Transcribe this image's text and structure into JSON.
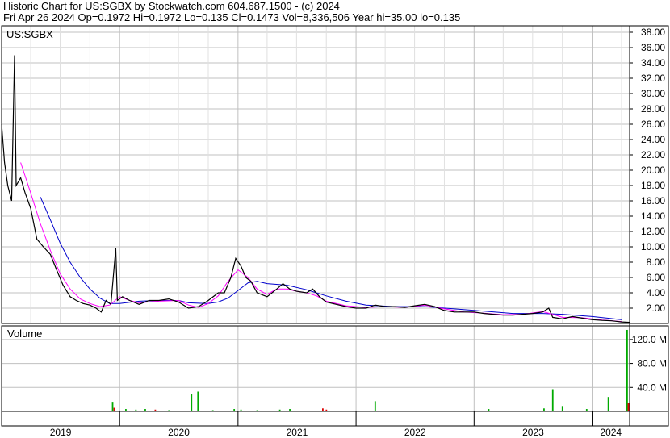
{
  "header": {
    "title": "Historic Chart for US:SGBX by Stockwatch.com 604.687.1500 - (c) 2024",
    "quote": "Fri Apr 26 2024   Op=0.1972  Hi=0.1972  Lo=0.135  Cl=0.1473  Vol=8,336,506  Year hi=35.00  lo=0.135"
  },
  "chart_data": {
    "type": "line",
    "symbol": "US:SGBX",
    "volume_label": "Volume",
    "price_ylim": [
      0,
      38
    ],
    "price_ticks": [
      "2.00",
      "4.00",
      "6.00",
      "8.00",
      "10.00",
      "12.00",
      "14.00",
      "16.00",
      "18.00",
      "20.00",
      "22.00",
      "24.00",
      "26.00",
      "28.00",
      "30.00",
      "32.00",
      "34.00",
      "36.00",
      "38.00"
    ],
    "volume_ylim": [
      0,
      140
    ],
    "volume_ticks": [
      "40.0 M",
      "80.0 M",
      "120.0 M"
    ],
    "x_labels": [
      "2019",
      "2020",
      "2021",
      "2022",
      "2023",
      "2024"
    ],
    "x_range": [
      "2019-01-01",
      "2024-04-26"
    ],
    "grid": true,
    "colors": {
      "price": "#000000",
      "ma_short": "#ff00ff",
      "ma_long": "#0000cc",
      "vol_up": "#00aa00",
      "vol_down": "#dd0000",
      "grid": "#c0c0c0"
    },
    "series": [
      {
        "key": "close",
        "points": [
          [
            "2019-01-01",
            26
          ],
          [
            "2019-01-10",
            21
          ],
          [
            "2019-01-20",
            18
          ],
          [
            "2019-02-01",
            16
          ],
          [
            "2019-02-10",
            35
          ],
          [
            "2019-02-15",
            18
          ],
          [
            "2019-03-01",
            19
          ],
          [
            "2019-03-15",
            17
          ],
          [
            "2019-04-01",
            15
          ],
          [
            "2019-04-20",
            11
          ],
          [
            "2019-05-10",
            10
          ],
          [
            "2019-06-01",
            9
          ],
          [
            "2019-06-20",
            7
          ],
          [
            "2019-07-10",
            5
          ],
          [
            "2019-08-01",
            3.5
          ],
          [
            "2019-08-20",
            3
          ],
          [
            "2019-09-10",
            2.6
          ],
          [
            "2019-10-01",
            2.4
          ],
          [
            "2019-10-20",
            2
          ],
          [
            "2019-11-05",
            1.5
          ],
          [
            "2019-11-20",
            3
          ],
          [
            "2019-12-05",
            2.5
          ],
          [
            "2019-12-20",
            9.8
          ],
          [
            "2019-12-25",
            3
          ],
          [
            "2020-01-10",
            3.5
          ],
          [
            "2020-02-01",
            3
          ],
          [
            "2020-03-01",
            2.5
          ],
          [
            "2020-04-01",
            3
          ],
          [
            "2020-05-01",
            3
          ],
          [
            "2020-06-01",
            3.2
          ],
          [
            "2020-07-01",
            2.8
          ],
          [
            "2020-08-01",
            2
          ],
          [
            "2020-09-01",
            2.2
          ],
          [
            "2020-10-01",
            3
          ],
          [
            "2020-11-01",
            4
          ],
          [
            "2020-11-20",
            4
          ],
          [
            "2020-12-10",
            6
          ],
          [
            "2020-12-25",
            8.5
          ],
          [
            "2021-01-10",
            7.5
          ],
          [
            "2021-01-25",
            6
          ],
          [
            "2021-02-10",
            5.5
          ],
          [
            "2021-03-01",
            4
          ],
          [
            "2021-04-01",
            3.5
          ],
          [
            "2021-05-01",
            4.5
          ],
          [
            "2021-05-20",
            5.2
          ],
          [
            "2021-06-10",
            4.5
          ],
          [
            "2021-07-01",
            4.2
          ],
          [
            "2021-08-01",
            4
          ],
          [
            "2021-08-20",
            4.5
          ],
          [
            "2021-09-10",
            3.5
          ],
          [
            "2021-10-01",
            2.8
          ],
          [
            "2021-11-01",
            2.5
          ],
          [
            "2021-12-01",
            2.2
          ],
          [
            "2022-01-01",
            2
          ],
          [
            "2022-02-01",
            2
          ],
          [
            "2022-03-01",
            2.4
          ],
          [
            "2022-04-01",
            2.2
          ],
          [
            "2022-05-01",
            2.2
          ],
          [
            "2022-06-01",
            2.1
          ],
          [
            "2022-07-01",
            2.3
          ],
          [
            "2022-08-01",
            2.5
          ],
          [
            "2022-09-01",
            2.2
          ],
          [
            "2022-10-01",
            1.7
          ],
          [
            "2022-11-01",
            1.5
          ],
          [
            "2022-12-01",
            1.5
          ],
          [
            "2023-01-01",
            1.5
          ],
          [
            "2023-02-01",
            1.3
          ],
          [
            "2023-03-01",
            1.2
          ],
          [
            "2023-04-01",
            1.1
          ],
          [
            "2023-05-01",
            1.1
          ],
          [
            "2023-06-01",
            1.2
          ],
          [
            "2023-07-01",
            1.3
          ],
          [
            "2023-08-01",
            1.5
          ],
          [
            "2023-08-20",
            2
          ],
          [
            "2023-09-01",
            0.8
          ],
          [
            "2023-10-01",
            0.6
          ],
          [
            "2023-11-01",
            0.9
          ],
          [
            "2023-12-01",
            0.7
          ],
          [
            "2024-01-01",
            0.5
          ],
          [
            "2024-02-01",
            0.4
          ],
          [
            "2024-03-01",
            0.35
          ],
          [
            "2024-04-01",
            0.2
          ],
          [
            "2024-04-26",
            0.1473
          ]
        ]
      },
      {
        "key": "ma_short",
        "points": [
          [
            "2019-03-01",
            21
          ],
          [
            "2019-04-01",
            17
          ],
          [
            "2019-05-01",
            13
          ],
          [
            "2019-06-01",
            9.5
          ],
          [
            "2019-07-01",
            6.5
          ],
          [
            "2019-08-01",
            4.5
          ],
          [
            "2019-09-01",
            3.2
          ],
          [
            "2019-10-01",
            2.6
          ],
          [
            "2019-11-01",
            2.2
          ],
          [
            "2019-12-01",
            2.4
          ],
          [
            "2020-01-01",
            3.5
          ],
          [
            "2020-02-01",
            3
          ],
          [
            "2020-03-01",
            2.7
          ],
          [
            "2020-05-01",
            2.9
          ],
          [
            "2020-07-01",
            3
          ],
          [
            "2020-08-01",
            2.4
          ],
          [
            "2020-09-01",
            2.1
          ],
          [
            "2020-10-01",
            2.6
          ],
          [
            "2020-11-01",
            3.6
          ],
          [
            "2020-12-01",
            5.5
          ],
          [
            "2021-01-01",
            7
          ],
          [
            "2021-02-01",
            6
          ],
          [
            "2021-03-01",
            4.5
          ],
          [
            "2021-04-01",
            3.8
          ],
          [
            "2021-05-01",
            4.5
          ],
          [
            "2021-06-01",
            4.5
          ],
          [
            "2021-07-01",
            4.2
          ],
          [
            "2021-08-01",
            4
          ],
          [
            "2021-09-01",
            3.6
          ],
          [
            "2021-10-01",
            2.9
          ],
          [
            "2021-12-01",
            2.3
          ],
          [
            "2022-02-01",
            2.1
          ],
          [
            "2022-04-01",
            2.2
          ],
          [
            "2022-06-01",
            2.1
          ],
          [
            "2022-08-01",
            2.4
          ],
          [
            "2022-10-01",
            1.9
          ],
          [
            "2022-12-01",
            1.5
          ],
          [
            "2023-02-01",
            1.35
          ],
          [
            "2023-04-01",
            1.15
          ],
          [
            "2023-06-01",
            1.2
          ],
          [
            "2023-08-01",
            1.55
          ],
          [
            "2023-09-01",
            1.2
          ],
          [
            "2023-10-01",
            0.8
          ],
          [
            "2023-12-01",
            0.75
          ],
          [
            "2024-02-01",
            0.45
          ],
          [
            "2024-04-01",
            0.25
          ]
        ]
      },
      {
        "key": "ma_long",
        "points": [
          [
            "2019-05-01",
            16.5
          ],
          [
            "2019-06-01",
            13.5
          ],
          [
            "2019-07-01",
            10.5
          ],
          [
            "2019-08-01",
            8
          ],
          [
            "2019-09-01",
            6
          ],
          [
            "2019-10-01",
            4.5
          ],
          [
            "2019-11-01",
            3.3
          ],
          [
            "2019-12-01",
            2.6
          ],
          [
            "2020-01-01",
            2.6
          ],
          [
            "2020-03-01",
            2.9
          ],
          [
            "2020-05-01",
            3
          ],
          [
            "2020-07-01",
            3
          ],
          [
            "2020-08-01",
            2.7
          ],
          [
            "2020-10-01",
            2.6
          ],
          [
            "2020-11-01",
            2.8
          ],
          [
            "2020-12-01",
            3.3
          ],
          [
            "2021-01-01",
            4.3
          ],
          [
            "2021-02-01",
            5.3
          ],
          [
            "2021-03-01",
            5.5
          ],
          [
            "2021-04-01",
            5.2
          ],
          [
            "2021-06-01",
            5
          ],
          [
            "2021-08-01",
            4.4
          ],
          [
            "2021-10-01",
            3.6
          ],
          [
            "2021-12-01",
            2.9
          ],
          [
            "2022-02-01",
            2.4
          ],
          [
            "2022-05-01",
            2.2
          ],
          [
            "2022-08-01",
            2.2
          ],
          [
            "2022-11-01",
            1.9
          ],
          [
            "2023-02-01",
            1.6
          ],
          [
            "2023-05-01",
            1.3
          ],
          [
            "2023-08-01",
            1.3
          ],
          [
            "2023-10-01",
            1.2
          ],
          [
            "2024-01-01",
            0.9
          ],
          [
            "2024-04-01",
            0.5
          ]
        ]
      }
    ],
    "volume_bars": [
      [
        "2019-12-10",
        16,
        "green"
      ],
      [
        "2019-12-15",
        6,
        "red"
      ],
      [
        "2020-01-20",
        4,
        "green"
      ],
      [
        "2020-02-20",
        3,
        "green"
      ],
      [
        "2020-03-20",
        4,
        "green"
      ],
      [
        "2020-04-20",
        3,
        "red"
      ],
      [
        "2020-06-01",
        2,
        "green"
      ],
      [
        "2020-08-10",
        29,
        "green"
      ],
      [
        "2020-08-30",
        33,
        "green"
      ],
      [
        "2020-10-15",
        2,
        "green"
      ],
      [
        "2020-12-20",
        4,
        "green"
      ],
      [
        "2021-01-10",
        3,
        "green"
      ],
      [
        "2021-03-01",
        2,
        "green"
      ],
      [
        "2021-05-10",
        3,
        "green"
      ],
      [
        "2021-06-10",
        4,
        "green"
      ],
      [
        "2021-09-20",
        5,
        "red"
      ],
      [
        "2021-10-01",
        3,
        "red"
      ],
      [
        "2022-03-01",
        17,
        "green"
      ],
      [
        "2023-02-15",
        4,
        "green"
      ],
      [
        "2023-08-05",
        5,
        "green"
      ],
      [
        "2023-09-01",
        37,
        "green"
      ],
      [
        "2023-10-01",
        9,
        "green"
      ],
      [
        "2023-12-15",
        4,
        "green"
      ],
      [
        "2024-02-20",
        24,
        "green"
      ],
      [
        "2024-04-18",
        136,
        "green"
      ],
      [
        "2024-04-22",
        14,
        "red"
      ]
    ]
  }
}
